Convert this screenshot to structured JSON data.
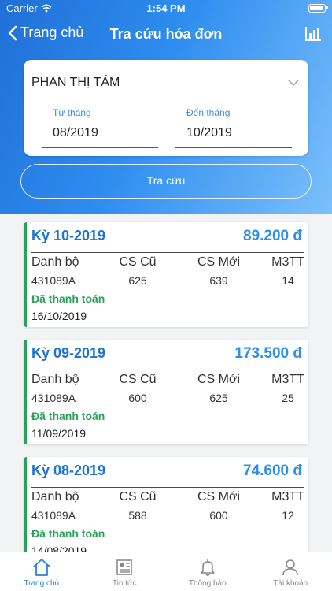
{
  "status_bar": {
    "carrier": "Carrier",
    "time": "1:54 PM"
  },
  "nav": {
    "back_label": "Trang chủ",
    "title": "Tra cứu hóa đơn",
    "right_icon": "bar-chart-icon"
  },
  "form": {
    "customer_name": "PHAN THỊ TÁM",
    "from_label": "Từ tháng",
    "from_value": "08/2019",
    "to_label": "Đến tháng",
    "to_value": "10/2019"
  },
  "search_button": "Tra cứu",
  "columns": {
    "account": "Danh bộ",
    "old_reading": "CS Cũ",
    "new_reading": "CS Mới",
    "m3": "M3TT"
  },
  "bills": [
    {
      "period": "Kỳ 10-2019",
      "amount": "89.200 đ",
      "account": "431089A",
      "old_reading": "625",
      "new_reading": "639",
      "m3": "14",
      "status": "Đã thanh toán",
      "date": "16/10/2019"
    },
    {
      "period": "Kỳ 09-2019",
      "amount": "173.500 đ",
      "account": "431089A",
      "old_reading": "600",
      "new_reading": "625",
      "m3": "25",
      "status": "Đã thanh toán",
      "date": "11/09/2019"
    },
    {
      "period": "Kỳ 08-2019",
      "amount": "74.600 đ",
      "account": "431089A",
      "old_reading": "588",
      "new_reading": "600",
      "m3": "12",
      "status": "Đã thanh toán",
      "date": "14/08/2019"
    }
  ],
  "tabs": [
    {
      "label": "Trang chủ",
      "icon": "home-icon",
      "active": true
    },
    {
      "label": "Tin tức",
      "icon": "newspaper-icon",
      "active": false
    },
    {
      "label": "Thông báo",
      "icon": "bell-icon",
      "active": false
    },
    {
      "label": "Tài khoản",
      "icon": "user-icon",
      "active": false
    }
  ],
  "colors": {
    "primary": "#1f74c9",
    "accent_paid": "#2aa15b",
    "amount": "#2d8fe6"
  }
}
